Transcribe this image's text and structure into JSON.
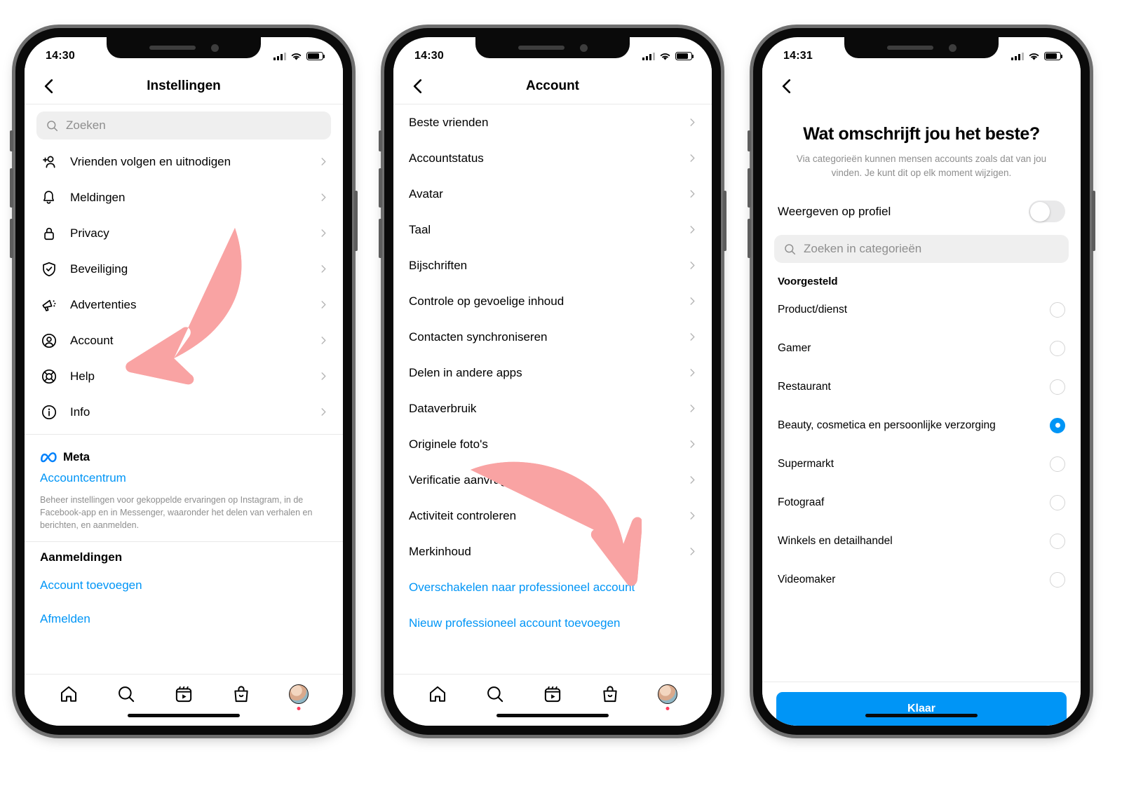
{
  "accent": {
    "blue": "#0095f6",
    "arrow_pink": "#f9a3a3",
    "gray_text": "#8e8e8e"
  },
  "phone1": {
    "status": {
      "time": "14:30"
    },
    "nav": {
      "title": "Instellingen",
      "back_icon": "chevron-left-icon"
    },
    "search": {
      "placeholder": "Zoeken",
      "icon": "search-icon"
    },
    "menu": [
      {
        "label": "Vrienden volgen en uitnodigen",
        "icon": "add-person-icon"
      },
      {
        "label": "Meldingen",
        "icon": "bell-icon"
      },
      {
        "label": "Privacy",
        "icon": "lock-icon"
      },
      {
        "label": "Beveiliging",
        "icon": "shield-check-icon"
      },
      {
        "label": "Advertenties",
        "icon": "megaphone-icon"
      },
      {
        "label": "Account",
        "icon": "account-circle-icon"
      },
      {
        "label": "Help",
        "icon": "lifebuoy-icon"
      },
      {
        "label": "Info",
        "icon": "info-circle-icon"
      }
    ],
    "meta": {
      "brand": "Meta",
      "brand_icon": "meta-infinity-icon",
      "link": "Accountcentrum",
      "description": "Beheer instellingen voor gekoppelde ervaringen op Instagram, in de Facebook-app en in Messenger, waaronder het delen van verhalen en berichten, en aanmelden."
    },
    "logins": {
      "heading": "Aanmeldingen",
      "add_account": "Account toevoegen",
      "logout": "Afmelden"
    },
    "tabs": [
      {
        "icon": "home-icon",
        "name": "home"
      },
      {
        "icon": "search-icon",
        "name": "search"
      },
      {
        "icon": "reels-icon",
        "name": "reels"
      },
      {
        "icon": "shop-bag-icon",
        "name": "shop"
      },
      {
        "icon": "avatar-icon",
        "name": "profile"
      }
    ]
  },
  "phone2": {
    "status": {
      "time": "14:30"
    },
    "nav": {
      "title": "Account",
      "back_icon": "chevron-left-icon"
    },
    "menu": [
      "Beste vrienden",
      "Accountstatus",
      "Avatar",
      "Taal",
      "Bijschriften",
      "Controle op gevoelige inhoud",
      "Contacten synchroniseren",
      "Delen in andere apps",
      "Dataverbruik",
      "Originele foto's",
      "Verificatie aanvragen",
      "Activiteit controleren",
      "Merkinhoud"
    ],
    "links": [
      "Overschakelen naar professioneel account",
      "Nieuw professioneel account toevoegen"
    ],
    "tabs": [
      {
        "icon": "home-icon",
        "name": "home"
      },
      {
        "icon": "search-icon",
        "name": "search"
      },
      {
        "icon": "reels-icon",
        "name": "reels"
      },
      {
        "icon": "shop-bag-icon",
        "name": "shop"
      },
      {
        "icon": "avatar-icon",
        "name": "profile"
      }
    ]
  },
  "phone3": {
    "status": {
      "time": "14:31"
    },
    "nav": {
      "back_icon": "chevron-left-icon"
    },
    "title": "Wat omschrijft jou het beste?",
    "subtitle": "Via categorieën kunnen mensen accounts zoals dat van jou vinden. Je kunt dit op elk moment wijzigen.",
    "toggle": {
      "label": "Weergeven op profiel",
      "state": "off"
    },
    "search": {
      "placeholder": "Zoeken in categorieën",
      "icon": "search-icon"
    },
    "section_heading": "Voorgesteld",
    "categories": [
      {
        "label": "Product/dienst",
        "selected": false
      },
      {
        "label": "Gamer",
        "selected": false
      },
      {
        "label": "Restaurant",
        "selected": false
      },
      {
        "label": "Beauty, cosmetica en persoonlijke verzorging",
        "selected": true
      },
      {
        "label": "Supermarkt",
        "selected": false
      },
      {
        "label": "Fotograaf",
        "selected": false
      },
      {
        "label": "Winkels en detailhandel",
        "selected": false
      },
      {
        "label": "Videomaker",
        "selected": false
      }
    ],
    "done_button": "Klaar"
  },
  "annotations": [
    {
      "name": "arrow-to-account",
      "target": "Account"
    },
    {
      "name": "arrow-to-switch-professional",
      "target": "Overschakelen naar professioneel account"
    }
  ]
}
